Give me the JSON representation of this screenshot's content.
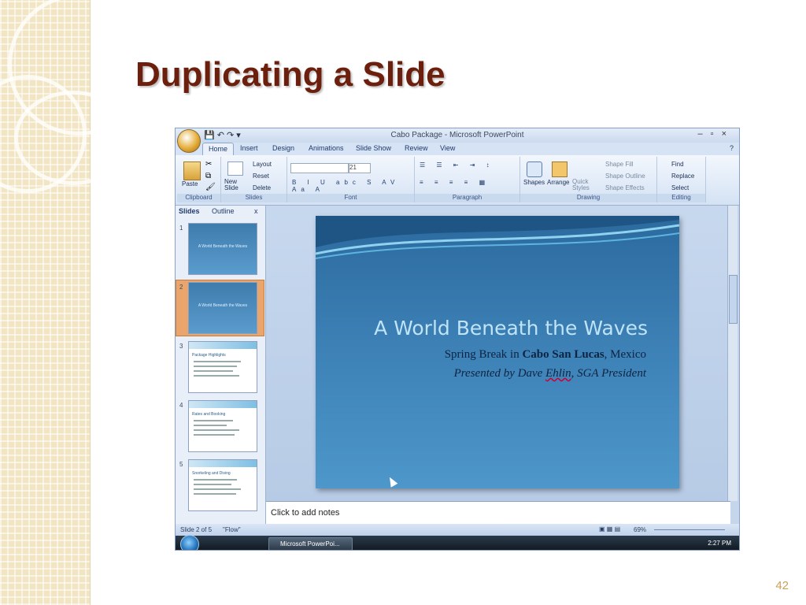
{
  "slide": {
    "title": "Duplicating a Slide",
    "page_number": "42"
  },
  "app": {
    "window_title": "Cabo Package - Microsoft PowerPoint",
    "tabs": [
      "Home",
      "Insert",
      "Design",
      "Animations",
      "Slide Show",
      "Review",
      "View"
    ],
    "ribbon": {
      "clipboard": {
        "paste": "Paste",
        "label": "Clipboard"
      },
      "slides": {
        "new_slide": "New Slide",
        "layout": "Layout",
        "reset": "Reset",
        "delete": "Delete",
        "label": "Slides"
      },
      "font": {
        "size": "21",
        "label": "Font"
      },
      "paragraph": {
        "label": "Paragraph"
      },
      "drawing": {
        "shapes": "Shapes",
        "arrange": "Arrange",
        "quick_styles": "Quick Styles",
        "shape_fill": "Shape Fill",
        "shape_outline": "Shape Outline",
        "shape_effects": "Shape Effects",
        "label": "Drawing"
      },
      "editing": {
        "find": "Find",
        "replace": "Replace",
        "select": "Select",
        "label": "Editing"
      }
    },
    "pane_tabs": {
      "slides": "Slides",
      "outline": "Outline",
      "close": "x"
    },
    "thumbnails": [
      {
        "num": "1",
        "title": "A World Beneath the Waves"
      },
      {
        "num": "2",
        "title": "A World Beneath the Waves"
      },
      {
        "num": "3",
        "title": "Package Highlights"
      },
      {
        "num": "4",
        "title": "Rates and Booking"
      },
      {
        "num": "5",
        "title": "Snorkeling and Diving"
      }
    ],
    "main_slide": {
      "title": "A World Beneath the Waves",
      "sub_prefix": "Spring Break in ",
      "sub_bold": "Cabo San Lucas",
      "sub_suffix": ", Mexico",
      "presenter_prefix": "Presented by Dave ",
      "presenter_name": "Ehlin",
      "presenter_suffix": ", SGA President"
    },
    "notes_placeholder": "Click to add notes",
    "status": {
      "slide_info": "Slide 2 of 5",
      "theme": "\"Flow\"",
      "zoom": "69%"
    },
    "taskbar": {
      "window_button": "Microsoft PowerPoi...",
      "clock": "2:27 PM"
    }
  }
}
